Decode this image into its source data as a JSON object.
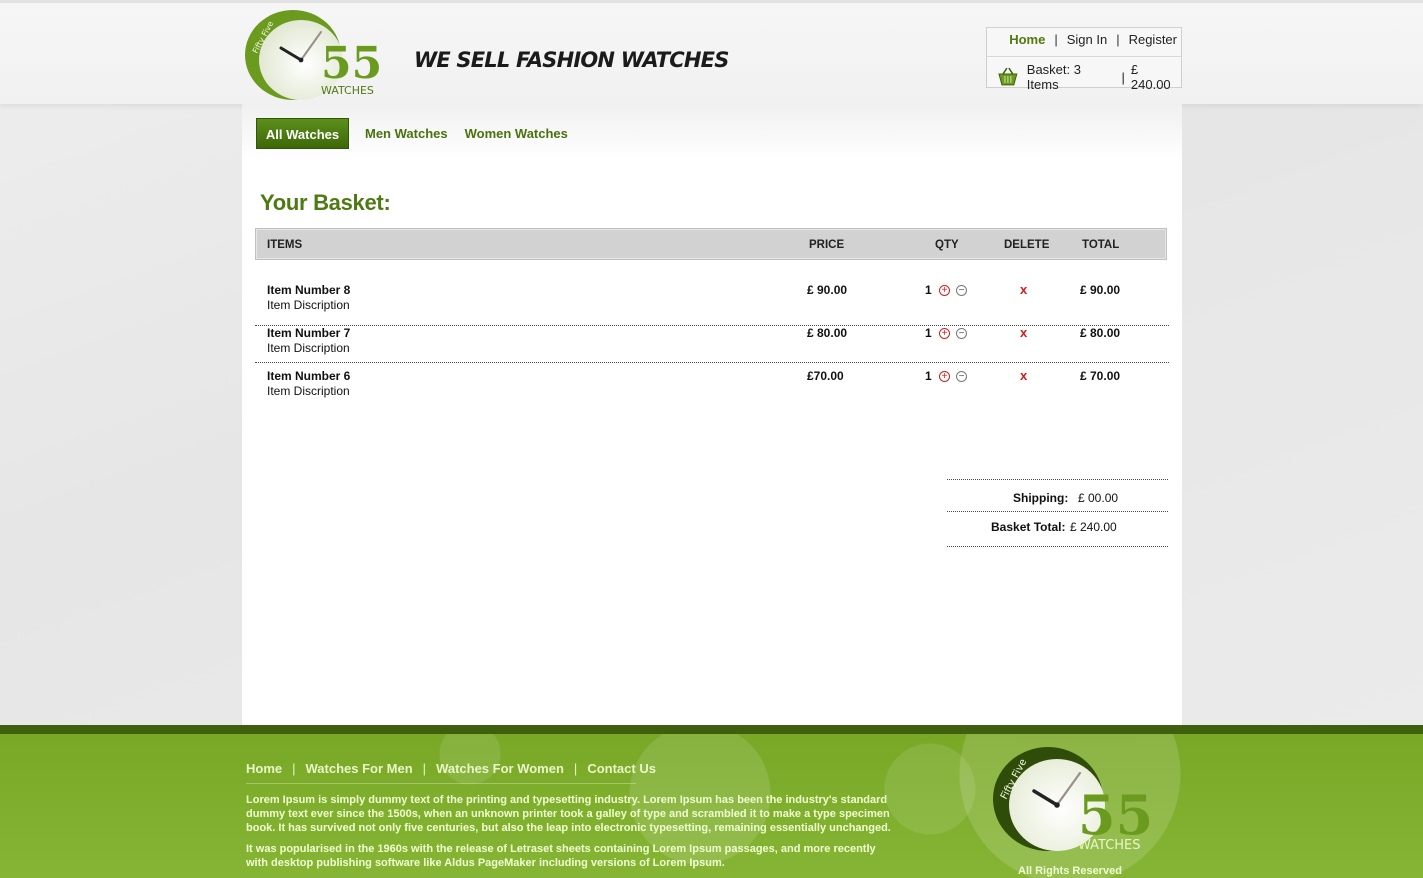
{
  "header": {
    "logo_text": "55",
    "logo_sub": "WATCHES",
    "logo_ring": "Fifty Five",
    "tagline": "WE SELL FASHION WATCHES",
    "links": {
      "home": "Home",
      "sign_in": "Sign In",
      "register": "Register",
      "separator": "|"
    },
    "basket": {
      "label": "Basket: 3 Items",
      "separator": "|",
      "amount": "£ 240.00"
    }
  },
  "nav": {
    "items": [
      "All Watches",
      "Men Watches",
      "Women Watches"
    ]
  },
  "basket": {
    "title": "Your Basket:",
    "columns": {
      "items": "ITEMS",
      "price": "PRICE",
      "qty": "QTY",
      "delete": "DELETE",
      "total": "TOTAL"
    },
    "rows": [
      {
        "name": "Item Number 8",
        "desc": "Item Discription",
        "price": "£ 90.00",
        "qty": "1",
        "delete": "x",
        "total": "£ 90.00"
      },
      {
        "name": "Item Number 7",
        "desc": "Item Discription",
        "price": "£ 80.00",
        "qty": "1",
        "delete": "x",
        "total": "£ 80.00"
      },
      {
        "name": "Item Number 6",
        "desc": "Item Discription",
        "price": "£70.00",
        "qty": "1",
        "delete": "x",
        "total": "£ 70.00"
      }
    ],
    "shipping_label": "Shipping:",
    "shipping_value": "£ 00.00",
    "total_label": "Basket Total:",
    "total_value": "£ 240.00"
  },
  "footer": {
    "nav": [
      "Home",
      "Watches For Men",
      "Watches For Women",
      "Contact Us"
    ],
    "separator": "|",
    "para1": "Lorem Ipsum is simply dummy text of the printing and typesetting industry. Lorem Ipsum has been the industry's standard dummy text ever since the 1500s, when an unknown printer took a galley of type and scrambled it to make a type specimen book. It has survived not only five centuries, but also the leap into electronic typesetting, remaining essentially unchanged.",
    "para2": "It was popularised in the 1960s with the release of Letraset sheets containing Lorem Ipsum passages, and more recently with desktop publishing software like Aldus PageMaker including versions of Lorem Ipsum.",
    "rights": "All Rights Reserved"
  },
  "icons": {
    "basket": "basket-icon",
    "plus": "plus-circle-icon",
    "minus": "minus-circle-icon",
    "delete": "close-icon"
  },
  "colors": {
    "brand_green": "#4d7a12",
    "nav_active": "#4a7812",
    "footer_green": "#7fae2c",
    "delete_red": "#d51a1a"
  }
}
